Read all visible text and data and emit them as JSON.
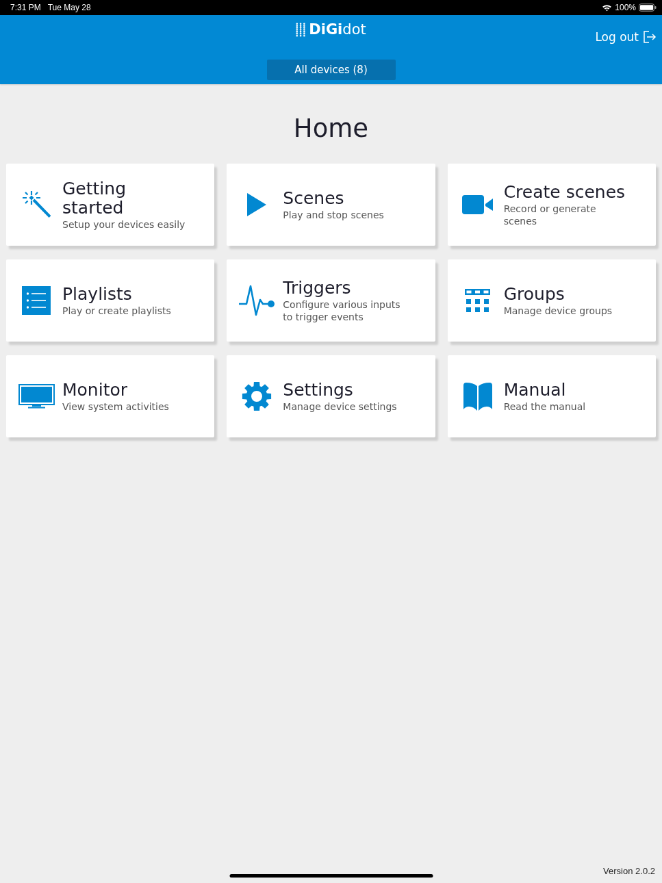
{
  "status_bar": {
    "time": "7:31 PM",
    "date": "Tue May 28",
    "battery": "100%"
  },
  "header": {
    "logo": "**DiGi**dot",
    "logout": "Log out",
    "devices_button": "All devices (8)"
  },
  "page_title": "Home",
  "tiles": [
    {
      "kind": "wand",
      "title": "Getting started",
      "subtitle": "Setup your devices easily"
    },
    {
      "kind": "play",
      "title": "Scenes",
      "subtitle": "Play and stop scenes"
    },
    {
      "kind": "video",
      "title": "Create scenes",
      "subtitle": "Record or generate scenes"
    },
    {
      "kind": "list",
      "title": "Playlists",
      "subtitle": "Play or create playlists"
    },
    {
      "kind": "pulse",
      "title": "Triggers",
      "subtitle": "Configure various inputs to trigger events"
    },
    {
      "kind": "grid",
      "title": "Groups",
      "subtitle": "Manage device groups"
    },
    {
      "kind": "monitor",
      "title": "Monitor",
      "subtitle": "View system activities"
    },
    {
      "kind": "gear",
      "title": "Settings",
      "subtitle": "Manage device settings"
    },
    {
      "kind": "book",
      "title": "Manual",
      "subtitle": "Read the manual"
    }
  ],
  "version": "Version 2.0.2"
}
